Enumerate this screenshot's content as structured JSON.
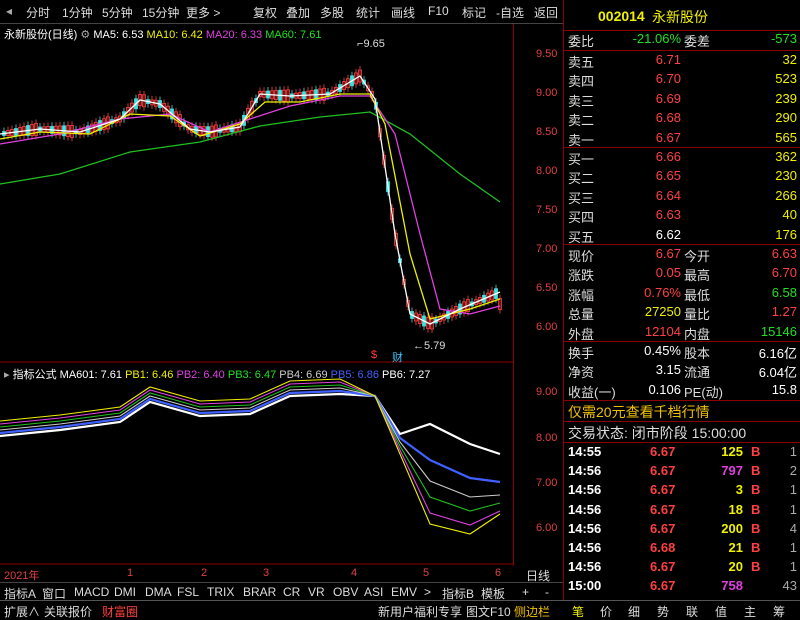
{
  "toolbar": {
    "items": [
      "分时",
      "1分钟",
      "5分钟",
      "15分钟",
      "更多 >",
      "复权",
      "叠加",
      "多股",
      "统计",
      "画线",
      "F10",
      "标记",
      "-自选",
      "返回"
    ]
  },
  "chart_title": {
    "name": "永新股份(日线)",
    "ma5": "MA5: 6.53",
    "ma10": "MA10: 6.42",
    "ma20": "MA20: 6.33",
    "ma60": "MA60: 7.61"
  },
  "price_axis": [
    "9.50",
    "9.00",
    "8.50",
    "8.00",
    "7.50",
    "7.00",
    "6.50",
    "6.00"
  ],
  "high_mark": "9.65",
  "low_mark": "5.79",
  "markers": {
    "dollar": "$",
    "cai": "财"
  },
  "indicator_title": {
    "name": "指标公式",
    "ma601": "MA601: 7.61",
    "pb1": "PB1: 6.46",
    "pb2": "PB2: 6.40",
    "pb3": "PB3: 6.47",
    "pb4": "PB4: 6.69",
    "pb5": "PB5: 6.86",
    "pb6": "PB6: 7.27"
  },
  "ind_axis": [
    "9.00",
    "8.00",
    "7.00",
    "6.00"
  ],
  "time_axis": {
    "year": "2021年",
    "months": [
      "1",
      "2",
      "3",
      "4",
      "5",
      "6"
    ],
    "period": "日线"
  },
  "tabs": [
    "指标A",
    "窗口",
    "MACD",
    "DMI",
    "DMA",
    "FSL",
    "TRIX",
    "BRAR",
    "CR",
    "VR",
    "OBV",
    "ASI",
    "EMV",
    ">",
    "指标B",
    "模板",
    "+",
    "-"
  ],
  "bottom_left": [
    "扩展∧",
    "关联报价",
    "财富圈"
  ],
  "promo": "新用户福利专享",
  "f10_label": "图文F10",
  "sidebar_label": "侧边栏",
  "status_tabs": [
    "笔",
    "价",
    "细",
    "势",
    "联",
    "值",
    "主",
    "筹"
  ],
  "stock": {
    "code": "002014",
    "name": "永新股份"
  },
  "quote": {
    "weibi_label": "委比",
    "weibi": "-21.06%",
    "weicha_label": "委差",
    "weicha": "-573",
    "asks": [
      {
        "label": "卖五",
        "price": "6.71",
        "vol": "32"
      },
      {
        "label": "卖四",
        "price": "6.70",
        "vol": "523"
      },
      {
        "label": "卖三",
        "price": "6.69",
        "vol": "239"
      },
      {
        "label": "卖二",
        "price": "6.68",
        "vol": "290"
      },
      {
        "label": "卖一",
        "price": "6.67",
        "vol": "565"
      }
    ],
    "bids": [
      {
        "label": "买一",
        "price": "6.66",
        "vol": "362"
      },
      {
        "label": "买二",
        "price": "6.65",
        "vol": "230"
      },
      {
        "label": "买三",
        "price": "6.64",
        "vol": "266"
      },
      {
        "label": "买四",
        "price": "6.63",
        "vol": "40"
      },
      {
        "label": "买五",
        "price": "6.62",
        "vol": "176"
      }
    ],
    "stats": [
      {
        "l1": "现价",
        "v1": "6.67",
        "l2": "今开",
        "v2": "6.63"
      },
      {
        "l1": "涨跌",
        "v1": "0.05",
        "l2": "最高",
        "v2": "6.70"
      },
      {
        "l1": "涨幅",
        "v1": "0.76%",
        "l2": "最低",
        "v2": "6.58"
      },
      {
        "l1": "总量",
        "v1": "27250",
        "l2": "量比",
        "v2": "1.27"
      },
      {
        "l1": "外盘",
        "v1": "12104",
        "l2": "内盘",
        "v2": "15146"
      }
    ],
    "stats2": [
      {
        "l1": "换手",
        "v1": "0.45%",
        "l2": "股本",
        "v2": "6.16亿"
      },
      {
        "l1": "净资",
        "v1": "3.15",
        "l2": "流通",
        "v2": "6.04亿"
      },
      {
        "l1": "收益(一)",
        "v1": "0.106",
        "l2": "PE(动)",
        "v2": "15.8"
      }
    ],
    "promo": "仅需20元查看千档行情",
    "trade_status": "交易状态: 闭市阶段 15:00:00",
    "ticks": [
      {
        "t": "14:55",
        "p": "6.67",
        "v": "125",
        "d": "B",
        "n": "1"
      },
      {
        "t": "14:56",
        "p": "6.67",
        "v": "797",
        "d": "B",
        "n": "2"
      },
      {
        "t": "14:56",
        "p": "6.67",
        "v": "3",
        "d": "B",
        "n": "1"
      },
      {
        "t": "14:56",
        "p": "6.67",
        "v": "18",
        "d": "B",
        "n": "1"
      },
      {
        "t": "14:56",
        "p": "6.67",
        "v": "200",
        "d": "B",
        "n": "4"
      },
      {
        "t": "14:56",
        "p": "6.68",
        "v": "21",
        "d": "B",
        "n": "1"
      },
      {
        "t": "14:56",
        "p": "6.67",
        "v": "20",
        "d": "B",
        "n": "1"
      },
      {
        "t": "15:00",
        "p": "6.67",
        "v": "758",
        "d": "",
        "n": "43"
      }
    ]
  }
}
